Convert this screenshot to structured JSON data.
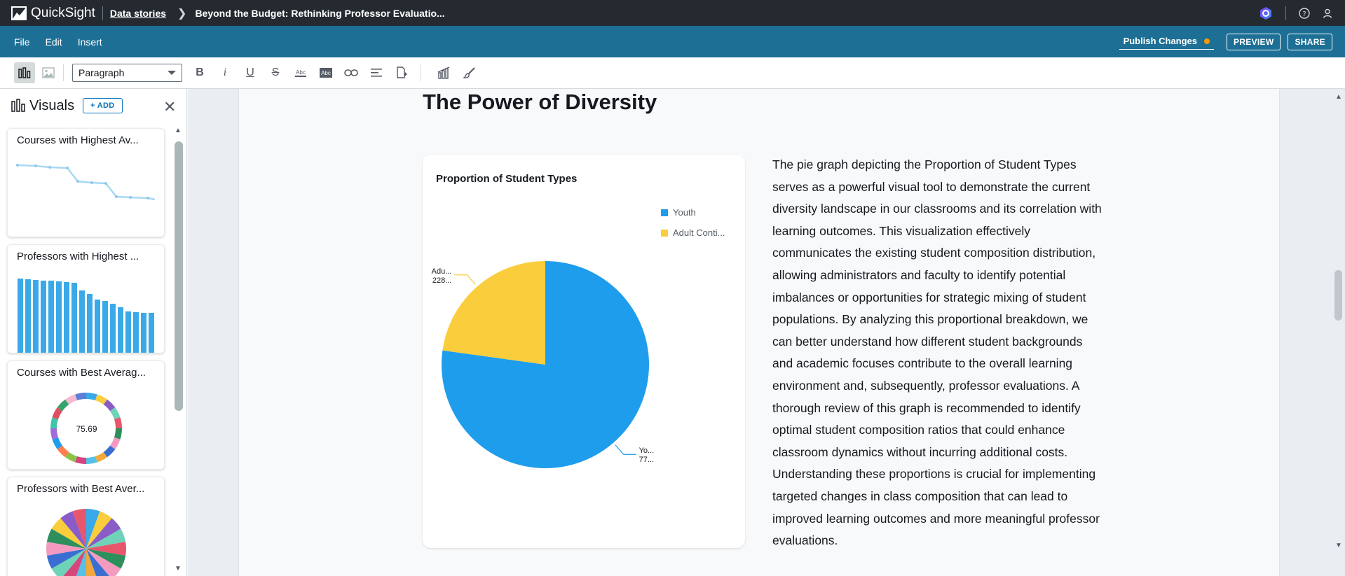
{
  "app": {
    "name": "QuickSight",
    "breadcrumb_link": "Data stories",
    "breadcrumb_title": "Beyond the Budget: Rethinking Professor Evaluatio..."
  },
  "menu": {
    "file": "File",
    "edit": "Edit",
    "insert": "Insert",
    "publish": "Publish Changes",
    "preview": "PREVIEW",
    "share": "SHARE"
  },
  "toolbar": {
    "paragraph_style": "Paragraph"
  },
  "visuals_panel": {
    "title": "Visuals",
    "add_label": "+ ADD",
    "cards": [
      {
        "title": "Courses with Highest Av...",
        "kind": "line"
      },
      {
        "title": "Professors with Highest ...",
        "kind": "bar"
      },
      {
        "title": "Courses with Best Averag...",
        "kind": "donut",
        "center_value": "75.69"
      },
      {
        "title": "Professors with Best Aver...",
        "kind": "pie"
      }
    ]
  },
  "story": {
    "heading": "The Power of Diversity",
    "paragraph": "The pie graph depicting the Proportion of Student Types serves as a powerful visual tool to demonstrate the current diversity landscape in our classrooms and its correlation with learning outcomes. This visualization effectively communicates the existing student composition distribution, allowing administrators and faculty to identify potential imbalances or opportunities for strategic mixing of student populations. By analyzing this proportional breakdown, we can better understand how different student backgrounds and academic focuses contribute to the overall learning environment and, subsequently, professor evaluations. A thorough review of this graph is recommended to identify optimal student composition ratios that could enhance classroom dynamics without incurring additional costs. Understanding these proportions is crucial for implementing targeted changes in class composition that can lead to improved learning outcomes and more meaningful professor evaluations."
  },
  "colors": {
    "youth": "#1f9ded",
    "adult": "#f9cd3c",
    "menubar": "#1d6f95",
    "topbar": "#252a31"
  },
  "chart_data": {
    "type": "pie",
    "title": "Proportion of Student Types",
    "legend": [
      "Youth",
      "Adult Conti..."
    ],
    "slices": [
      {
        "name": "Youth",
        "label_line1": "Yo...",
        "label_line2": "77...",
        "value": 77.2,
        "color": "#1f9ded"
      },
      {
        "name": "Adult Conti...",
        "label_line1": "Adu...",
        "label_line2": "228...",
        "value": 22.8,
        "color": "#f9cd3c"
      }
    ],
    "legend_placement": "top-right"
  }
}
